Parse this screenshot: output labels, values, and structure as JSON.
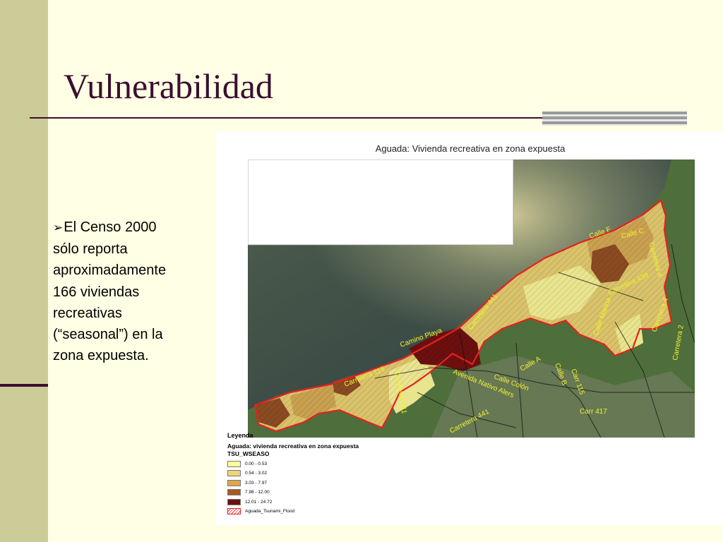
{
  "slide": {
    "title": "Vulnerabilidad",
    "bullet_lines": [
      "El Censo 2000",
      "sólo reporta",
      "aproximadamente",
      "166 viviendas",
      "recreativas",
      "(“seasonal”) en la",
      "zona expuesta."
    ]
  },
  "map": {
    "title": "Aguada: Vivienda recreativa en zona expuesta",
    "street_labels": [
      "Calle F",
      "Calle C",
      "Carretera 4",
      "Carretera 439",
      "Calle Marina",
      "Carretera 4",
      "Carretera 2",
      "Carretera 441",
      "Camino Playa",
      "Calle A",
      "Calle Colón",
      "Avenida Nativo Alers",
      "Calle B",
      "Carr 115",
      "Carretera 115",
      "Carretera 441",
      "Carr 417",
      "Carretera 441"
    ],
    "colors": {
      "accent": "#3A0F2E",
      "background": "#FFFFE5",
      "sidebar": "#CCCC99",
      "flood_outline": "#E52020",
      "street_label": "#F2F230"
    }
  },
  "legend": {
    "title": "Leyenda",
    "subtitle": "Aguada: vivienda recreativa en zona expuesta",
    "field": "TSU_WSEASO",
    "items": [
      {
        "label": "0.00 - 0.53",
        "color": "#FFFF99"
      },
      {
        "label": "0.54 - 3.02",
        "color": "#F2D27A"
      },
      {
        "label": "3.03 - 7.97",
        "color": "#E0A64A"
      },
      {
        "label": "7.98 - 12.00",
        "color": "#A85A1E"
      },
      {
        "label": "12.01 - 24.72",
        "color": "#6B0F0F"
      }
    ],
    "flood_label": "Aguada_Tsunami_Flood"
  }
}
